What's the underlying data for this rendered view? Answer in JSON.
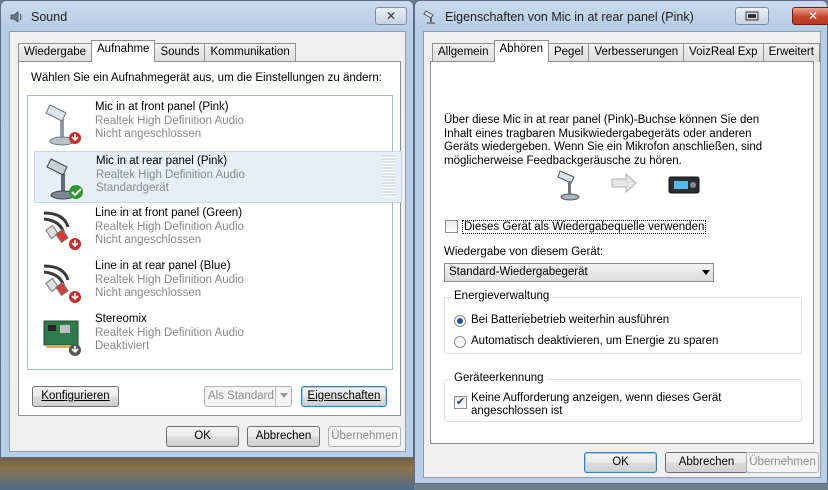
{
  "sound_window": {
    "title": "Sound",
    "close_label": "✕",
    "tabs": [
      {
        "label": "Wiedergabe",
        "selected": false
      },
      {
        "label": "Aufnahme",
        "selected": true
      },
      {
        "label": "Sounds",
        "selected": false
      },
      {
        "label": "Kommunikation",
        "selected": false
      }
    ],
    "instruction": "Wählen Sie ein Aufnahmegerät aus, um die Einstellungen zu ändern:",
    "devices": [
      {
        "name": "Mic in at front panel (Pink)",
        "driver": "Realtek High Definition Audio",
        "status": "Nicht angeschlossen",
        "icon": "microphone-icon"
      },
      {
        "name": "Mic in at rear panel (Pink)",
        "driver": "Realtek High Definition Audio",
        "status": "Standardgerät",
        "icon": "microphone-icon",
        "selected": true
      },
      {
        "name": "Line in at front panel (Green)",
        "driver": "Realtek High Definition Audio",
        "status": "Nicht angeschlossen",
        "icon": "line-in-cable-icon"
      },
      {
        "name": "Line in at rear panel (Blue)",
        "driver": "Realtek High Definition Audio",
        "status": "Nicht angeschlossen",
        "icon": "line-in-cable-icon"
      },
      {
        "name": "Stereomix",
        "driver": "Realtek High Definition Audio",
        "status": "Deaktiviert",
        "icon": "sound-card-icon"
      }
    ],
    "configure_label": "Konfigurieren",
    "set_default_label": "Als Standard",
    "properties_label": "Eigenschaften",
    "ok_label": "OK",
    "cancel_label": "Abbrechen",
    "apply_label": "Übernehmen"
  },
  "props_window": {
    "title": "Eigenschaften von Mic in at rear panel (Pink)",
    "close_label": "✕",
    "tabs": [
      {
        "label": "Allgemein",
        "selected": false
      },
      {
        "label": "Abhören",
        "selected": true
      },
      {
        "label": "Pegel",
        "selected": false
      },
      {
        "label": "Verbesserungen",
        "selected": false
      },
      {
        "label": "VoizReal Exp",
        "selected": false
      },
      {
        "label": "Erweitert",
        "selected": false
      }
    ],
    "description": "Über diese Mic in at rear panel (Pink)-Buchse können Sie den Inhalt eines tragbaren Musikwiedergabegeräts oder anderen Geräts wiedergeben. Wenn Sie ein Mikrofon anschließen, sind möglicherweise Feedbackgeräusche zu hören.",
    "listen_checkbox_label": "Dieses Gerät als Wiedergabequelle verwenden",
    "listen_checked": false,
    "playback_label": "Wiedergabe von diesem Gerät:",
    "playback_value": "Standard-Wiedergabegerät",
    "power_group_label": "Energieverwaltung",
    "power_option_1": "Bei Batteriebetrieb weiterhin ausführen",
    "power_option_2": "Automatisch deaktivieren, um Energie zu sparen",
    "power_selected": 1,
    "detection_group_label": "Geräteerkennung",
    "detection_checkbox_label": "Keine Aufforderung anzeigen, wenn dieses Gerät angeschlossen ist",
    "detection_checked": true,
    "ok_label": "OK",
    "cancel_label": "Abbrechen",
    "apply_label": "Übernehmen"
  }
}
